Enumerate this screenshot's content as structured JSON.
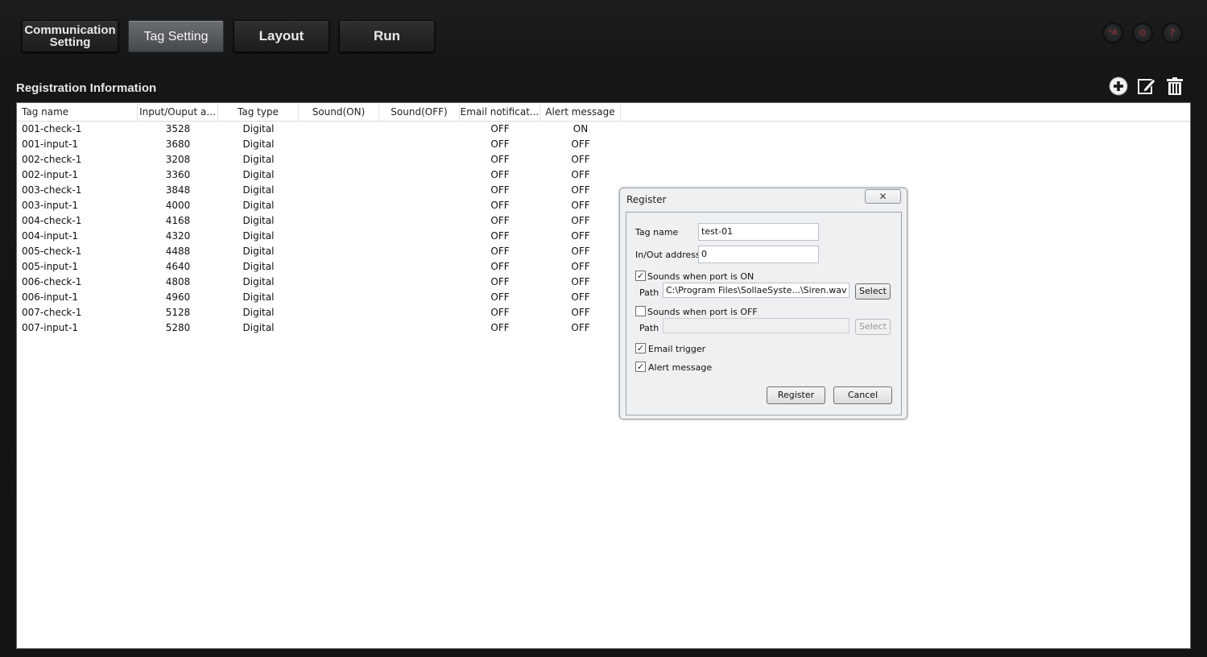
{
  "nav": {
    "comm_line1": "Communication",
    "comm_line2": "Setting",
    "tag_setting": "Tag Setting",
    "layout": "Layout",
    "run": "Run",
    "active_color": "#5a5e62"
  },
  "top_icons": {
    "language": "ᴬA",
    "settings": "⚙",
    "help": "?"
  },
  "section": {
    "title": "Registration Information"
  },
  "table": {
    "columns": [
      "Tag name",
      "Input/Ouput a...",
      "Tag type",
      "Sound(ON)",
      "Sound(OFF)",
      "Email notificat...",
      "Alert message"
    ],
    "rows": [
      [
        "001-check-1",
        "3528",
        "Digital",
        "",
        "",
        "OFF",
        "ON"
      ],
      [
        "001-input-1",
        "3680",
        "Digital",
        "",
        "",
        "OFF",
        "OFF"
      ],
      [
        "002-check-1",
        "3208",
        "Digital",
        "",
        "",
        "OFF",
        "OFF"
      ],
      [
        "002-input-1",
        "3360",
        "Digital",
        "",
        "",
        "OFF",
        "OFF"
      ],
      [
        "003-check-1",
        "3848",
        "Digital",
        "",
        "",
        "OFF",
        "OFF"
      ],
      [
        "003-input-1",
        "4000",
        "Digital",
        "",
        "",
        "OFF",
        "OFF"
      ],
      [
        "004-check-1",
        "4168",
        "Digital",
        "",
        "",
        "OFF",
        "OFF"
      ],
      [
        "004-input-1",
        "4320",
        "Digital",
        "",
        "",
        "OFF",
        "OFF"
      ],
      [
        "005-check-1",
        "4488",
        "Digital",
        "",
        "",
        "OFF",
        "OFF"
      ],
      [
        "005-input-1",
        "4640",
        "Digital",
        "",
        "",
        "OFF",
        "OFF"
      ],
      [
        "006-check-1",
        "4808",
        "Digital",
        "",
        "",
        "OFF",
        "OFF"
      ],
      [
        "006-input-1",
        "4960",
        "Digital",
        "",
        "",
        "OFF",
        "OFF"
      ],
      [
        "007-check-1",
        "5128",
        "Digital",
        "",
        "",
        "OFF",
        "OFF"
      ],
      [
        "007-input-1",
        "5280",
        "Digital",
        "",
        "",
        "OFF",
        "OFF"
      ]
    ]
  },
  "dialog": {
    "title": "Register",
    "close": "✕",
    "tag_name_label": "Tag name",
    "tag_name_value": "test-01",
    "address_label": "In/Out address",
    "address_value": "0",
    "sound_on_label": "Sounds when port is ON",
    "sound_on_checked": true,
    "sound_on_path_label": "Path",
    "sound_on_path_value": "C:\\Program Files\\SollaeSyste...\\Siren.wav",
    "sound_on_select": "Select",
    "sound_off_label": "Sounds when port is OFF",
    "sound_off_checked": false,
    "sound_off_path_label": "Path",
    "sound_off_path_value": "",
    "sound_off_select": "Select",
    "email_label": "Email trigger",
    "email_checked": true,
    "alert_label": "Alert message",
    "alert_checked": true,
    "register_btn": "Register",
    "cancel_btn": "Cancel",
    "check_mark": "✓"
  }
}
